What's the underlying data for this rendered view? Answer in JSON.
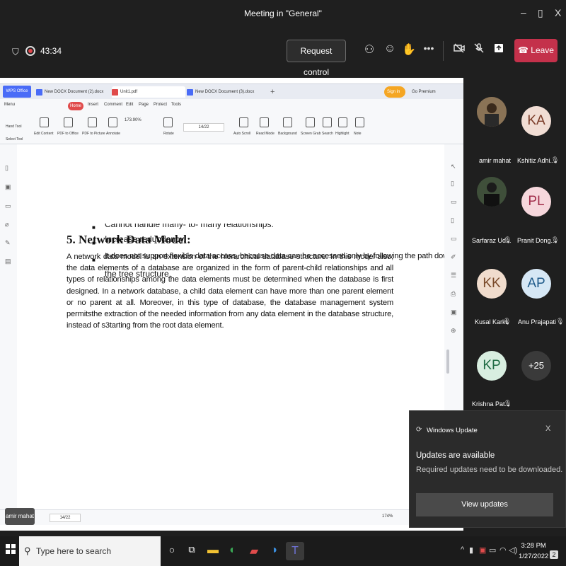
{
  "window": {
    "title": "Meeting in \"General\"",
    "min": "–",
    "max": "▯",
    "close": "X"
  },
  "meeting": {
    "timer": "43:34",
    "request_control": "Request control",
    "leave": "Leave",
    "leave_color": "#c4314b"
  },
  "wps": {
    "logo": "WPS Office",
    "tabs": [
      {
        "label": "New DOCX Document (2).docx"
      },
      {
        "label": "Unit1.pdf"
      },
      {
        "label": "New DOCX Document (3).docx"
      }
    ],
    "sign_in": "Sign in",
    "premium": "Go Premium",
    "menu": [
      "Menu",
      "Home",
      "Insert",
      "Comment",
      "Edit",
      "Page",
      "Protect",
      "Tools"
    ],
    "ribbon": {
      "hand_tool": "Hand Tool",
      "select_tool": "Select Tool",
      "edit_content": "Edit Content",
      "pdf_to_office": "PDF to Office",
      "pdf_to_picture": "PDF to Picture",
      "annotate": "Annotate",
      "zoom": "173.90%",
      "rotate": "Rotate",
      "page": "14/22",
      "auto_scroll": "Auto Scroll",
      "read_mode": "Read Mode",
      "background": "Background",
      "screen_grab": "Screen Grab",
      "search": "Search",
      "highlight": "Highlight",
      "note": "Note"
    },
    "status": {
      "page": "14/22",
      "zoom": "174%"
    }
  },
  "document": {
    "bullets": [
      "Cannot handle many- to- many relationships.",
      "Increase redundancy.",
      "It does not support flexible data access, because data can be accessed only by following the path down",
      "the tree structure."
    ],
    "heading": "5. Network Data Model:",
    "paragraph": " A network data model is an extension of the hierarchical database structure. In this model also, the data elements of a database are organized in the form of parent-child relationships and all types of relationships among the data elements must be determined when the database is first designed. In a network database, a child data element can have more than one parent element or no parent at all. Moreover, in this type of database, the database management system permitsthe extraction of the needed information from any data element in the database structure, instead of s3tarting from the root data element."
  },
  "presenter_tag": "amir mahat",
  "participants": [
    {
      "name": "amir mahat",
      "initials": "",
      "bg": "#5b4a3a",
      "fg": "#fff"
    },
    {
      "name": "Kshitiz Adhi...",
      "initials": "KA",
      "bg": "#f1ddd4",
      "fg": "#7a3b27"
    },
    {
      "name": "Sarfaraz Ud...",
      "initials": "",
      "bg": "#2f3b2f",
      "fg": "#fff"
    },
    {
      "name": "Pranit Dong...",
      "initials": "PL",
      "bg": "#f6d7dc",
      "fg": "#a12d4a"
    },
    {
      "name": "Kusal Karki",
      "initials": "KK",
      "bg": "#f0dccd",
      "fg": "#7a4a2a"
    },
    {
      "name": "Anu Prajapati",
      "initials": "AP",
      "bg": "#d6e7f5",
      "fg": "#1f5a8a"
    },
    {
      "name": "Krishna Pat...",
      "initials": "KP",
      "bg": "#d8eee0",
      "fg": "#1f6b43"
    },
    {
      "name": "",
      "initials": "+25",
      "bg": "#3a3a3a",
      "fg": "#fff"
    }
  ],
  "toast": {
    "app": "Windows Update",
    "close": "X",
    "title": "Updates are available",
    "subtitle": "Required updates need to be downloaded.",
    "button": "View updates"
  },
  "taskbar": {
    "search_placeholder": "Type here to search",
    "time": "3:28 PM",
    "date": "1/27/2022",
    "notif_count": "2"
  }
}
